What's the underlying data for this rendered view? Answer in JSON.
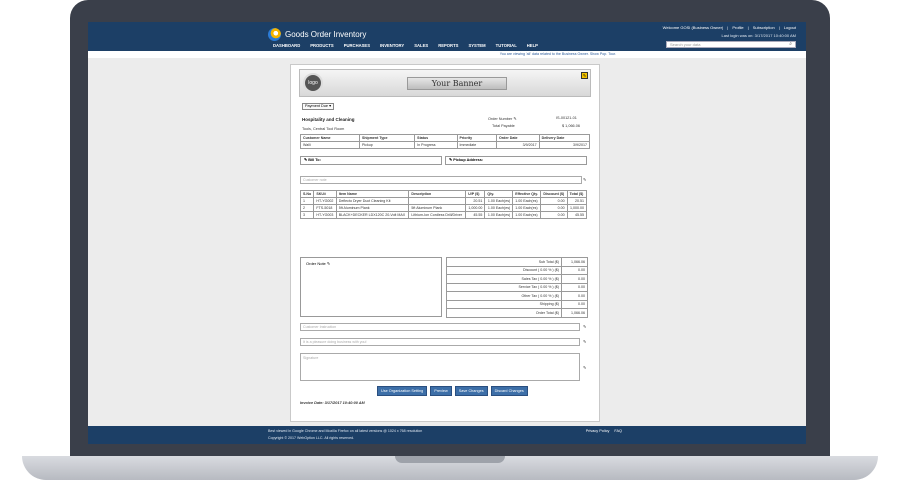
{
  "app": {
    "name": "Goods Order Inventory",
    "top_links": [
      "Welcome GOSI (Business Owner)",
      "|",
      "Profile",
      "|",
      "Subscription",
      "|",
      "Logout"
    ],
    "last_login": "Last login was on: 3/17/2017 10:40:00 AM",
    "nav": [
      "DASHBOARD",
      "PRODUCTS",
      "PURCHASES",
      "INVENTORY",
      "SALES",
      "REPORTS",
      "SYSTEM",
      "TUTORIAL",
      "HELP"
    ],
    "search_placeholder": "Search your data",
    "notice": "You are viewing 'all' data related to the Business Owner. Show Pop. Tour."
  },
  "invoice": {
    "logo": "logo",
    "banner": "Your Banner",
    "payment_select": "Payment Due",
    "company": "Hospitality and Cleaning",
    "address": "Tools, Central Tool Room",
    "order_number_label": "Order Number",
    "order_number": "IS-00121-01",
    "total_payable_label": "Total Payable",
    "total_payable": "$ 1,066.06",
    "customer_headers": [
      "Customer Name",
      "Shipment Type",
      "Status",
      "Priority",
      "Order Date",
      "Delivery Date"
    ],
    "customer_row": [
      "Walli",
      "Pickup",
      "In Progress",
      "Immediate",
      "3/9/2017",
      "3/9/2017"
    ],
    "bill_to": "Bill To:",
    "pickup_address": "Pickup Address:",
    "customer_note_placeholder": "Customer note",
    "item_headers": [
      "S.No",
      "SKU#",
      "Item Name",
      "Description",
      "U/P ($)",
      "Qty.",
      "Effective Qty.",
      "Discount ($)",
      "Total ($)"
    ],
    "items": [
      [
        "1",
        "HT-YG002",
        "Deflecto Dryer Duct Cleaning Kit",
        "",
        "20.51",
        "1.00 Each(es)",
        "1.00 Each(es)",
        "0.00",
        "20.51"
      ],
      [
        "2",
        "FTS-5018",
        "5ft Aluminum Plank",
        "5ft Aluminum Plank",
        "1,000.00",
        "1.00 Each(es)",
        "1.00 Each(es)",
        "0.00",
        "1,000.00"
      ],
      [
        "3",
        "HT-YG003",
        "BLACK+DECKER LDX120C 20-Volt MAX",
        "Lithium-Ion Cordless Drill/Driver",
        "45.55",
        "1.00 Each(es)",
        "1.00 Each(es)",
        "0.00",
        "45.55"
      ]
    ],
    "order_note": "Order Note",
    "totals": [
      [
        "Sub Total ($)",
        "1,066.06"
      ],
      [
        "Discount ( 0.00 % ) ($)",
        "0.00"
      ],
      [
        "Sales Tax ( 0.00 % ) ($)",
        "0.00"
      ],
      [
        "Service Tax ( 0.00 % ) ($)",
        "0.00"
      ],
      [
        "Other Tax ( 0.00 % ) ($)",
        "0.00"
      ],
      [
        "Shipping ($)",
        "0.00"
      ],
      [
        "Order Total ($)",
        "1,066.06"
      ]
    ],
    "customer_instruction_placeholder": "Customer Instruction",
    "thanks_placeholder": "It is a pleasure doing business with you!",
    "signature_placeholder": "Signature",
    "buttons": [
      "Use Organization Setting",
      "Preview",
      "Save Changes",
      "Discard Changes"
    ],
    "invoice_date": "Invoice Date: 3/17/2017 10:40:00 AM"
  },
  "footer": {
    "line1": "Best viewed in Google Chrome and Mozilla Firefox on all latest versions @ 1024 x 768 resolution",
    "line2": "Copyright © 2017 WebOption LLC. All rights reserved.",
    "links": [
      "Privacy Policy",
      "FAQ"
    ]
  },
  "colors": {
    "header": "#1c3f66",
    "button": "#3d6fa8",
    "accent_edit": "#f2c200"
  }
}
